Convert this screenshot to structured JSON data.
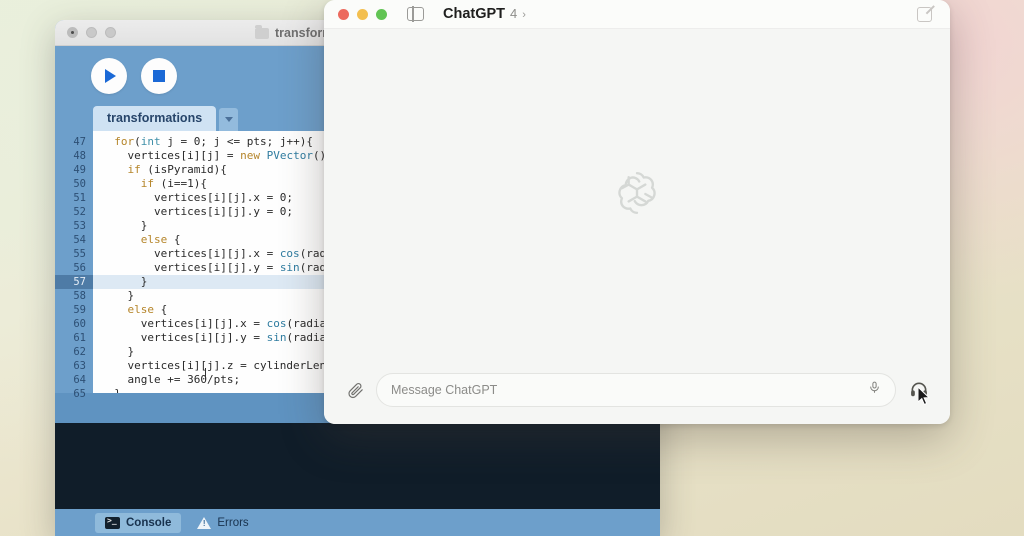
{
  "desktop": {
    "wallpaper_colors": [
      "#eaf0dc",
      "#f2d3d2",
      "#e3dcc0"
    ]
  },
  "processing_window": {
    "title": "transform",
    "folder_icon": "folder-icon",
    "traffic_lights": [
      "close",
      "minimize",
      "maximize"
    ],
    "toolbar": {
      "run_label": "Run",
      "stop_label": "Stop"
    },
    "tab": {
      "name": "transformations",
      "dropdown_label": "▾"
    },
    "editor": {
      "active_line": 57,
      "first_line": 47,
      "lines": [
        {
          "n": "47",
          "html": "  <span class='kw'>for</span>(<span class='kw2'>int</span> j = 0; j <= pts; j++){"
        },
        {
          "n": "48",
          "html": "    vertices[i][j] = <span class='kw'>new</span> <span class='fn'>PVector</span>();"
        },
        {
          "n": "49",
          "html": "    <span class='kw'>if</span> (isPyramid){"
        },
        {
          "n": "50",
          "html": "      <span class='kw'>if</span> (i==1){"
        },
        {
          "n": "51",
          "html": "        vertices[i][j].x = 0;"
        },
        {
          "n": "52",
          "html": "        vertices[i][j].y = 0;"
        },
        {
          "n": "53",
          "html": "      }"
        },
        {
          "n": "54",
          "html": "      <span class='kw'>else</span> {"
        },
        {
          "n": "55",
          "html": "        vertices[i][j].x = <span class='fn'>cos</span>(radi"
        },
        {
          "n": "56",
          "html": "        vertices[i][j].y = <span class='fn'>sin</span>(radi"
        },
        {
          "n": "57",
          "html": "      }"
        },
        {
          "n": "58",
          "html": "    }"
        },
        {
          "n": "59",
          "html": "    <span class='kw'>else</span> {"
        },
        {
          "n": "60",
          "html": "      vertices[i][j].x = <span class='fn'>cos</span>(radian"
        },
        {
          "n": "61",
          "html": "      vertices[i][j].y = <span class='fn'>sin</span>(radian"
        },
        {
          "n": "62",
          "html": "    }"
        },
        {
          "n": "63",
          "html": "    vertices[i][j].z = cylinderLeng"
        },
        {
          "n": "64",
          "html": "    angle += 360/pts;"
        },
        {
          "n": "65",
          "html": "  }"
        }
      ]
    },
    "statusbar": {
      "console_tab": "Console",
      "errors_tab": "Errors",
      "console_icon": "terminal-icon",
      "errors_icon": "warning-triangle-icon",
      "active_tab": "Console"
    }
  },
  "chatgpt_window": {
    "titlebar": {
      "traffic_lights": {
        "close": "#ec6a5e",
        "minimize": "#f3bf4f",
        "maximize": "#61c454"
      },
      "sidebar_toggle_icon": "sidebar-toggle-icon",
      "app_title": "ChatGPT",
      "model": "4",
      "model_chevron": "›",
      "new_chat_icon": "compose-icon"
    },
    "body": {
      "watermark_icon": "openai-logo",
      "empty_state": ""
    },
    "composer": {
      "attach_icon": "paperclip-icon",
      "placeholder": "Message ChatGPT",
      "value": "",
      "mic_icon": "microphone-icon",
      "voice_mode_icon": "headphones-icon"
    }
  }
}
